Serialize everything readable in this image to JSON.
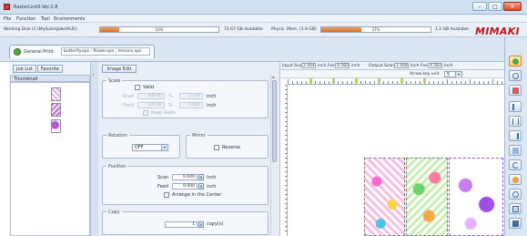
{
  "window": {
    "title": "RasterLink6 Ver.2.8",
    "minimize": "–",
    "maximize": "□",
    "close": "✕"
  },
  "menu": [
    "File",
    "Function",
    "Tool",
    "Environments"
  ],
  "status": {
    "working_disk_label": "Working Disk (C:\\MySuite\\Jobs\\RL6\\)",
    "working_disk_pct": "16%",
    "working_disk_pct_value": 16,
    "working_disk_available": "72.67 GB Available",
    "phys_mem_label": "Physic. Mem. (1.9 GB)",
    "phys_mem_pct": "37%",
    "phys_mem_pct_value": 37,
    "phys_mem_available": "1.2 GB Available",
    "brand": "MIMAKI"
  },
  "doc_tab": {
    "label": "General Print",
    "filename": "butterfly.eps ; flower.eps ; lemons.eps"
  },
  "left_panel": {
    "tabs": [
      "Job List",
      "Favorite"
    ],
    "thumbnail_header": "Thumbnail"
  },
  "image_edit": {
    "tab": "Image Edit",
    "scale": {
      "caption": "Scale",
      "valid_label": "Valid",
      "scan_label": "Scan",
      "scan_value": "100.00",
      "scan_pct": "%",
      "scan_inch": "2.444",
      "feed_label": "Feed",
      "feed_value": "100.00",
      "feed_pct": "%",
      "feed_inch": "4.583",
      "inch": "inch",
      "keep_ratio": "Keep Ratio"
    },
    "rotation": {
      "caption": "Rotation",
      "value": "OFF"
    },
    "mirror": {
      "caption": "Mirror",
      "reverse": "Reverse"
    },
    "position": {
      "caption": "Position",
      "scan_label": "Scan",
      "scan_value": "0.000",
      "feed_label": "Feed",
      "feed_value": "0.000",
      "inch": "inch",
      "arrange_center": "Arrange in the Center"
    },
    "copy": {
      "caption": "Copy",
      "value": "1",
      "unit": "copy(s)"
    }
  },
  "preview": {
    "input_scan_label": "Input Scan",
    "input_scan_value": "2.444",
    "input_feed_label": "inch  Feed",
    "input_feed_value": "4.583",
    "inch": "inch",
    "output_scan_label": "Output Scan",
    "output_scan_value": "2.444",
    "output_feed_label": "inch  Feed",
    "output_feed_value": "4.583",
    "arrow_key_label": "Arrow key unit",
    "arrow_key_value": "5"
  }
}
